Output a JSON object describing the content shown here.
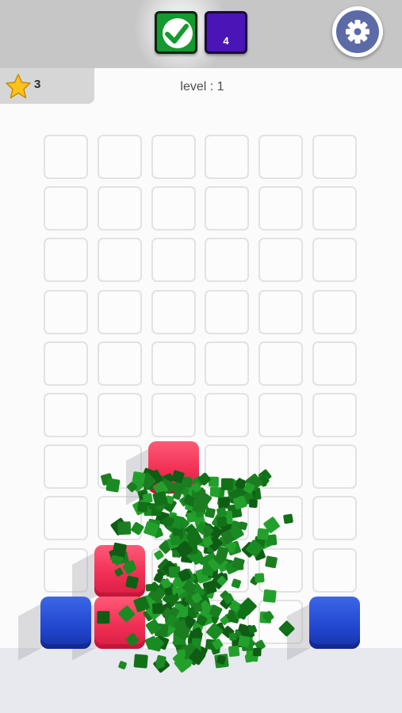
{
  "header": {
    "completed_icon": "checkmark-icon",
    "next_tile_count": "4",
    "settings_icon": "gear-icon",
    "colors": {
      "green": "#149a2e",
      "purple": "#4a15b6",
      "settings": "#5c6ba8"
    }
  },
  "stars": {
    "icon": "star-icon",
    "count": "3"
  },
  "level_label": "level : 1",
  "board": {
    "columns": 6,
    "rows": 10,
    "blocks": [
      {
        "color": "red",
        "col": 3,
        "row": 7
      },
      {
        "color": "red",
        "col": 2,
        "row": 9
      },
      {
        "color": "red",
        "col": 2,
        "row": 10
      },
      {
        "color": "blue",
        "col": 1,
        "row": 10
      },
      {
        "color": "blue",
        "col": 6,
        "row": 10
      }
    ],
    "block_colors": {
      "red": "#f12f54",
      "blue": "#2146cf",
      "particles": "#1a8a22"
    }
  }
}
